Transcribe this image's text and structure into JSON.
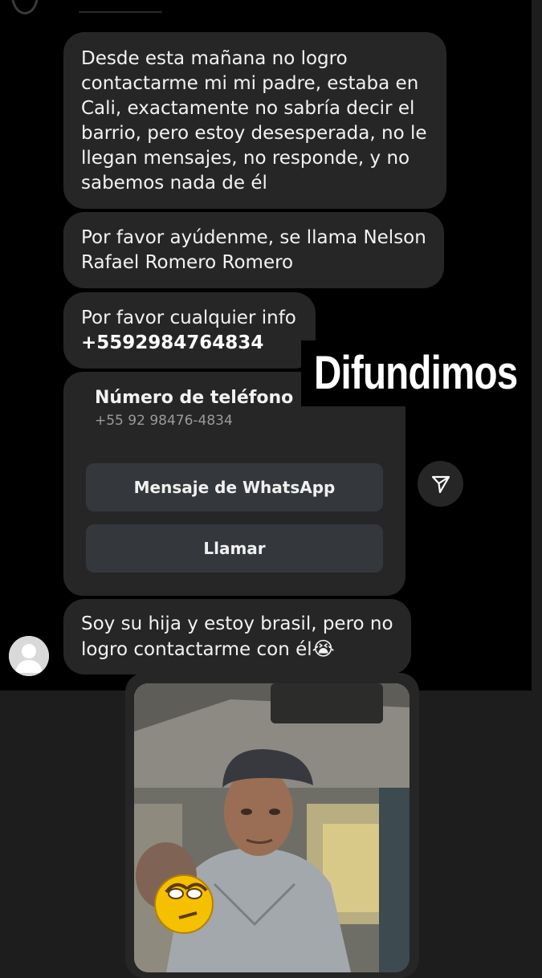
{
  "messages": [
    {
      "lines": [
        "Desde esta mañana no logro",
        "contactarme mi mi padre, estaba en",
        "Cali, exactamente no sabría decir el",
        "barrio, pero estoy desesperada, no le",
        "llegan mensajes, no responde, y no",
        "sabemos nada de él"
      ]
    },
    {
      "lines": [
        "Por favor ayúdenme, se llama Nelson",
        "Rafael Romero Romero"
      ]
    },
    {
      "text": "Por favor cualquier info",
      "phone": "+5592984764834"
    },
    {
      "lines": [
        "Soy su hija y estoy brasil, pero no",
        "logro contactarme con él"
      ],
      "emoji": "😭"
    }
  ],
  "phone_card": {
    "title": "Número de teléfono",
    "number": "+55 92 98476-4834",
    "whatsapp_label": "Mensaje de WhatsApp",
    "call_label": "Llamar"
  },
  "overlay_caption": "Difundimos",
  "icons": {
    "share": "share-send-icon",
    "avatar": "default-avatar-icon",
    "sticker": "crying-emoji-sticker"
  },
  "colors": {
    "chat_background": "#000000",
    "bubble": "#262626",
    "card_button": "#34373c",
    "page_background": "#1d1d1d"
  }
}
